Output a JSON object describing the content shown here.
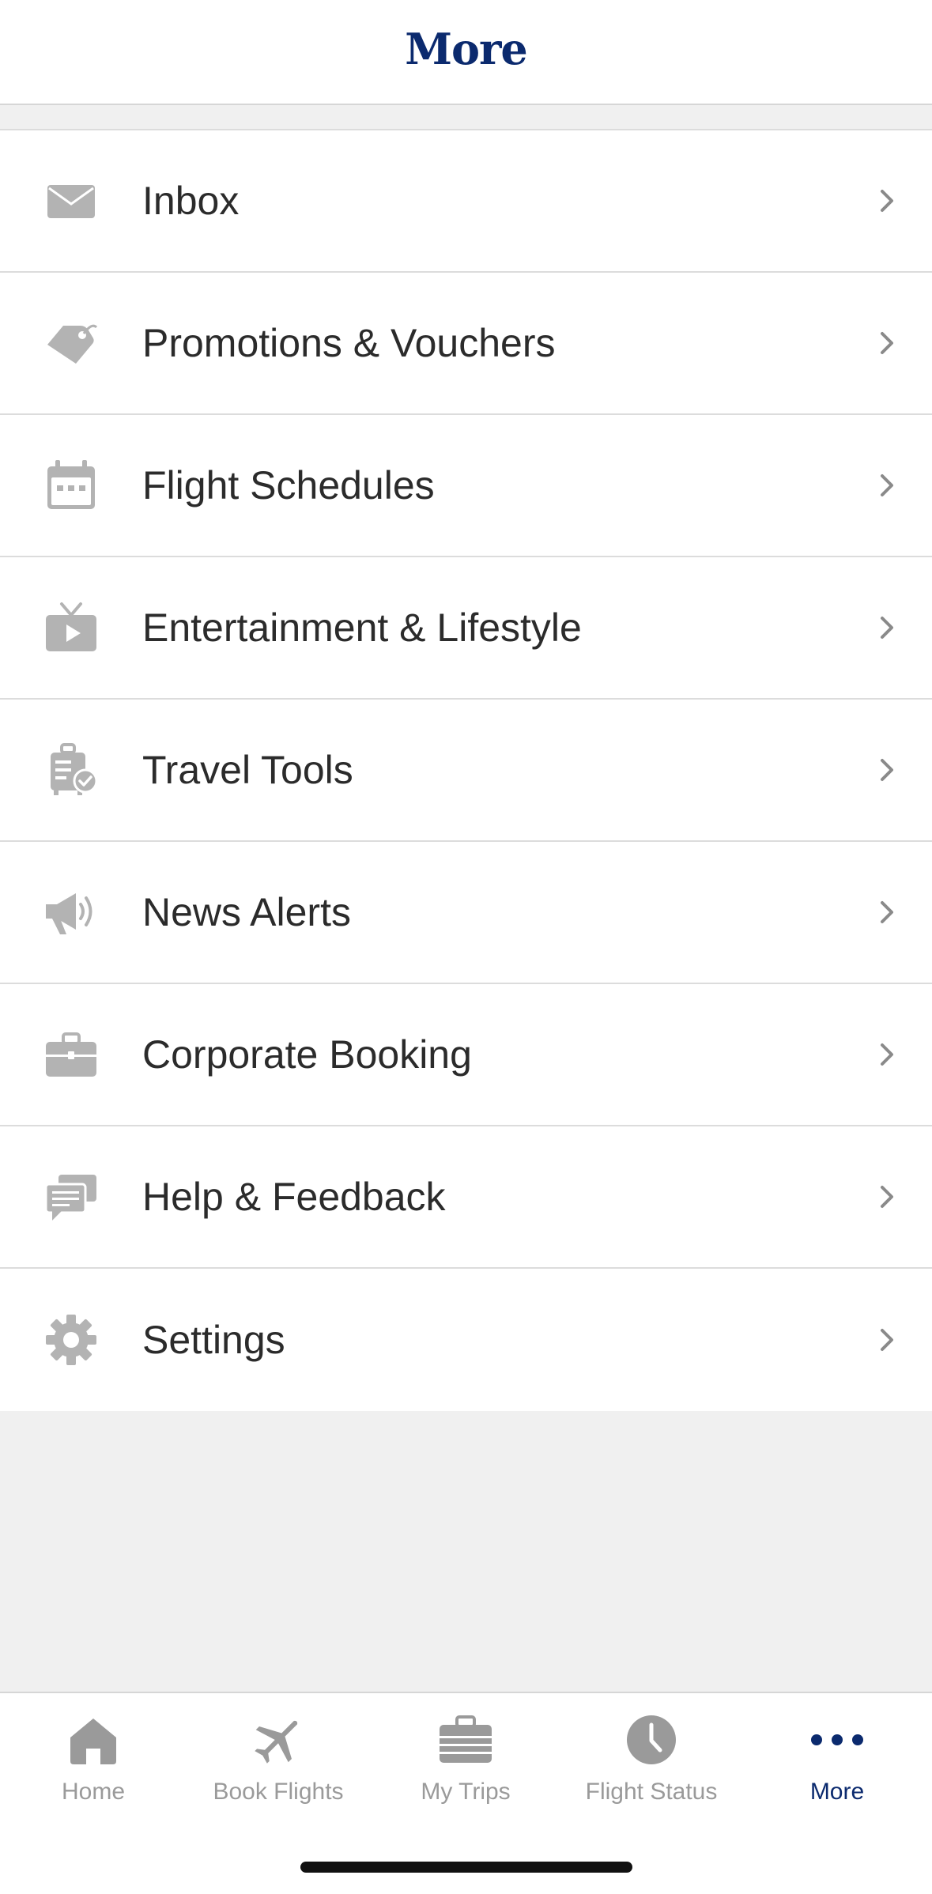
{
  "header": {
    "title": "More"
  },
  "menu": [
    {
      "label": "Inbox",
      "icon": "envelope-icon"
    },
    {
      "label": "Promotions & Vouchers",
      "icon": "tag-icon"
    },
    {
      "label": "Flight Schedules",
      "icon": "calendar-icon"
    },
    {
      "label": "Entertainment & Lifestyle",
      "icon": "tv-icon"
    },
    {
      "label": "Travel Tools",
      "icon": "luggage-check-icon"
    },
    {
      "label": "News Alerts",
      "icon": "megaphone-icon"
    },
    {
      "label": "Corporate Booking",
      "icon": "briefcase-icon"
    },
    {
      "label": "Help & Feedback",
      "icon": "chat-bubbles-icon"
    },
    {
      "label": "Settings",
      "icon": "gear-icon"
    }
  ],
  "tabbar": {
    "tabs": [
      {
        "label": "Home",
        "icon": "house-icon",
        "active": false
      },
      {
        "label": "Book Flights",
        "icon": "airplane-icon",
        "active": false
      },
      {
        "label": "My Trips",
        "icon": "suitcase-icon",
        "active": false
      },
      {
        "label": "Flight Status",
        "icon": "clock-icon",
        "active": false
      },
      {
        "label": "More",
        "icon": "more-dots-icon",
        "active": true
      }
    ]
  },
  "colors": {
    "brand": "#0b2a6e",
    "icon_gray": "#b3b3b3",
    "tab_inactive": "#9a9a9a",
    "background": "#f0f0f0"
  }
}
